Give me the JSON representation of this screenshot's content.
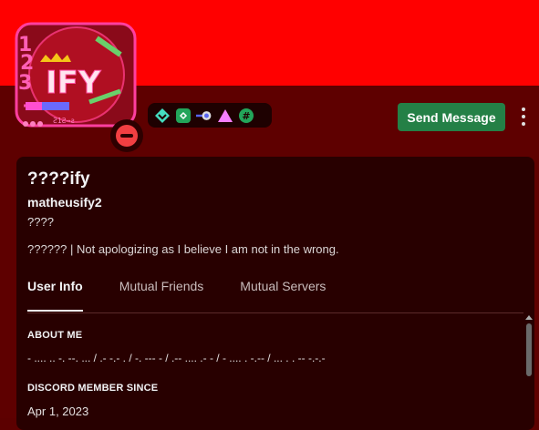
{
  "profile": {
    "display_name": "????ify",
    "username": "matheusify2",
    "pronouns": "????",
    "custom_status": "?????? | Not apologizing as I believe I am not in the wrong.",
    "avatar_text": "IFY",
    "avatar_digits": "123",
    "status": "dnd"
  },
  "actions": {
    "send_message_label": "Send Message",
    "more_icon": "more-vertical-icon"
  },
  "badges": [
    {
      "name": "hypesquad-icon",
      "color": "#45ddc0"
    },
    {
      "name": "nitro-icon",
      "color": "#23a55a"
    },
    {
      "name": "boost-icon",
      "color": "#b9bbbe"
    },
    {
      "name": "triangle-badge-icon",
      "color": "#f47fff"
    },
    {
      "name": "hashtag-badge-icon",
      "color": "#23a55a"
    }
  ],
  "tabs": {
    "user_info": "User Info",
    "mutual_friends": "Mutual Friends",
    "mutual_servers": "Mutual Servers"
  },
  "about_me": {
    "title": "ABOUT ME",
    "text": "- .... .. -. --. ... / .- -.- . / -. --- - / .-- .... .- - / - .... . -.-- / ... . . -- -.-.-"
  },
  "member_since": {
    "title": "DISCORD MEMBER SINCE",
    "date": "Apr 1, 2023"
  },
  "colors": {
    "banner": "#ff0000",
    "background": "#5e0000",
    "card": "#280000",
    "button": "#248046",
    "status_dnd": "#f23f42"
  }
}
